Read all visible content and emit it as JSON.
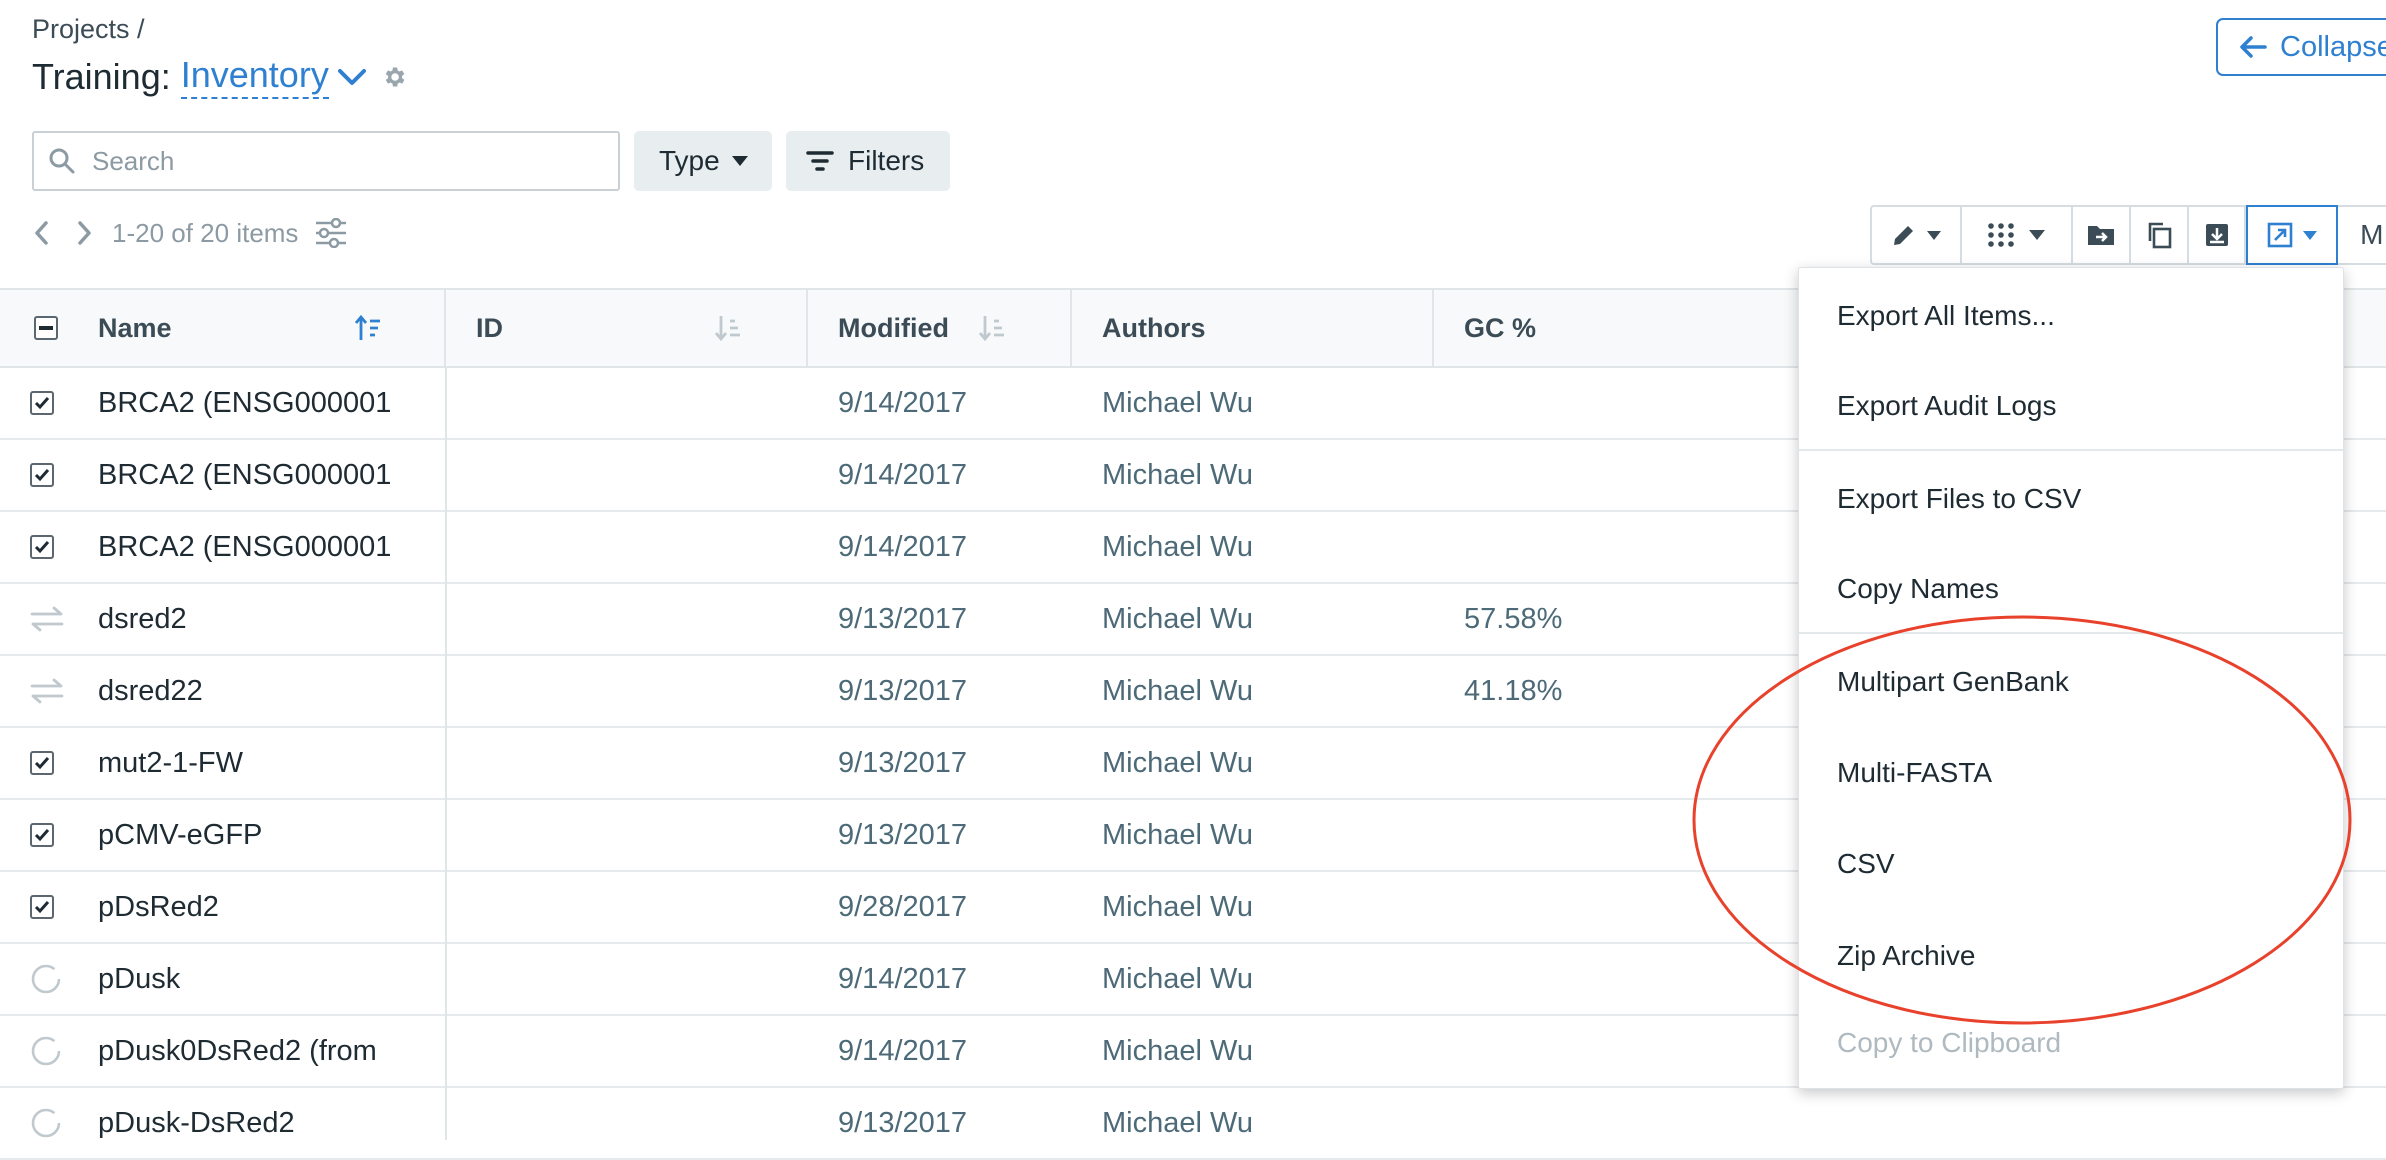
{
  "breadcrumb": "Projects /",
  "title": {
    "prefix": "Training:",
    "project": "Inventory"
  },
  "collapse_button": "Collapse",
  "search": {
    "placeholder": "Search",
    "value": ""
  },
  "filters": {
    "type_label": "Type",
    "filters_label": "Filters"
  },
  "pagination": {
    "label": "1-20 of 20 items"
  },
  "toolbar": {
    "more_label": "M"
  },
  "table": {
    "columns": [
      {
        "key": "name",
        "label": "Name"
      },
      {
        "key": "id",
        "label": "ID"
      },
      {
        "key": "modified",
        "label": "Modified"
      },
      {
        "key": "authors",
        "label": "Authors"
      },
      {
        "key": "gc",
        "label": "GC %"
      }
    ],
    "rows": [
      {
        "icon": "checkbox-checked",
        "name": "BRCA2 (ENSG000001",
        "modified": "9/14/2017",
        "author": "Michael Wu",
        "gc": ""
      },
      {
        "icon": "checkbox-checked",
        "name": "BRCA2 (ENSG000001",
        "modified": "9/14/2017",
        "author": "Michael Wu",
        "gc": ""
      },
      {
        "icon": "checkbox-checked",
        "name": "BRCA2 (ENSG000001",
        "modified": "9/14/2017",
        "author": "Michael Wu",
        "gc": ""
      },
      {
        "icon": "swap-arrows",
        "name": "dsred2",
        "modified": "9/13/2017",
        "author": "Michael Wu",
        "gc": "57.58%"
      },
      {
        "icon": "swap-arrows",
        "name": "dsred22",
        "modified": "9/13/2017",
        "author": "Michael Wu",
        "gc": "41.18%"
      },
      {
        "icon": "checkbox-checked",
        "name": "mut2-1-FW",
        "modified": "9/13/2017",
        "author": "Michael Wu",
        "gc": ""
      },
      {
        "icon": "checkbox-checked",
        "name": "pCMV-eGFP",
        "modified": "9/13/2017",
        "author": "Michael Wu",
        "gc": ""
      },
      {
        "icon": "checkbox-checked",
        "name": "pDsRed2",
        "modified": "9/28/2017",
        "author": "Michael Wu",
        "gc": ""
      },
      {
        "icon": "circular-plasmid",
        "name": "pDusk",
        "modified": "9/14/2017",
        "author": "Michael Wu",
        "gc": ""
      },
      {
        "icon": "circular-plasmid",
        "name": "pDusk0DsRed2 (from",
        "modified": "9/14/2017",
        "author": "Michael Wu",
        "gc": ""
      },
      {
        "icon": "circular-plasmid",
        "name": "pDusk-DsRed2",
        "modified": "9/13/2017",
        "author": "Michael Wu",
        "gc": ""
      }
    ]
  },
  "export_menu": {
    "items": [
      {
        "label": "Export All Items...",
        "enabled": true
      },
      {
        "label": "Export Audit Logs",
        "enabled": true
      },
      {
        "label": "Export Files to CSV",
        "enabled": true
      },
      {
        "label": "Copy Names",
        "enabled": true
      },
      {
        "label": "Multipart GenBank",
        "enabled": true
      },
      {
        "label": "Multi-FASTA",
        "enabled": true
      },
      {
        "label": "CSV",
        "enabled": true
      },
      {
        "label": "Zip Archive",
        "enabled": true
      },
      {
        "label": "Copy to Clipboard",
        "enabled": false
      }
    ]
  },
  "colors": {
    "accent": "#2f80d1",
    "annotation": "#e8412c",
    "text": "#1e2b33",
    "muted": "#4d6a78"
  }
}
